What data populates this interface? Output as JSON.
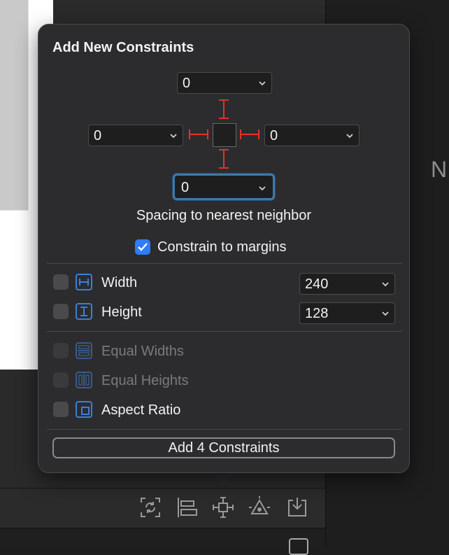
{
  "background": {
    "right_text": "N"
  },
  "popover": {
    "title": "Add New Constraints",
    "spacing": {
      "top": "0",
      "left": "0",
      "right": "0",
      "bottom": "0"
    },
    "spacing_label": "Spacing to nearest neighbor",
    "constrain_to_margins": {
      "label": "Constrain to margins",
      "checked": true
    },
    "dimensions": [
      {
        "label": "Width",
        "value": "240",
        "checked": false,
        "icon": "width-icon"
      },
      {
        "label": "Height",
        "value": "128",
        "checked": false,
        "icon": "height-icon"
      }
    ],
    "equality": [
      {
        "label": "Equal Widths",
        "enabled": false,
        "icon": "equal-widths-icon"
      },
      {
        "label": "Equal Heights",
        "enabled": false,
        "icon": "equal-heights-icon"
      },
      {
        "label": "Aspect Ratio",
        "enabled": true,
        "icon": "aspect-ratio-icon"
      }
    ],
    "add_button_label": "Add 4 Constraints"
  },
  "toolbar": {
    "icons": [
      "update-frames-icon",
      "align-icon",
      "add-constraints-icon",
      "resolve-issues-icon",
      "embed-in-icon"
    ]
  },
  "colors": {
    "accent": "#2f7cf6",
    "strut": "#e0322a",
    "focus_ring": "#3f78a9"
  }
}
